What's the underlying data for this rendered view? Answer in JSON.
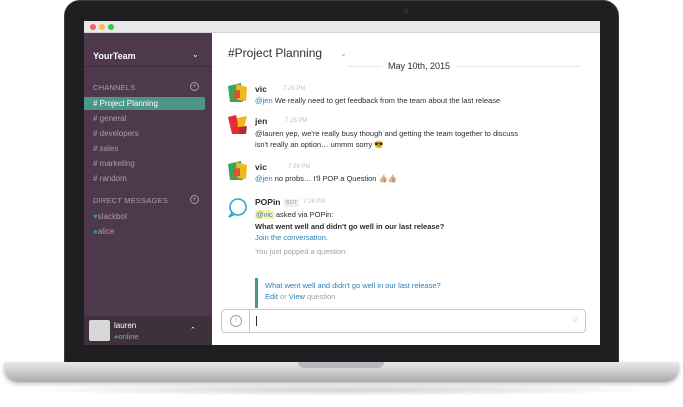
{
  "window": {
    "dots": [
      "#fc605c",
      "#fdbc40",
      "#34c84a"
    ]
  },
  "sidebar": {
    "team_name": "YourTeam",
    "team_caret": "⌄",
    "channels_heading": "CHANNELS",
    "add_channel": "+",
    "channels": [
      {
        "label": "# Project Planning",
        "active": true
      },
      {
        "label": "# general"
      },
      {
        "label": "# developers"
      },
      {
        "label": "# sales"
      },
      {
        "label": "# marketing"
      },
      {
        "label": "# random"
      }
    ],
    "dm_heading": "DIRECT MESSAGES",
    "add_dm": "+",
    "dms": [
      {
        "presence": "♥",
        "label": "slackbot"
      },
      {
        "presence": "●",
        "label": "alice"
      }
    ],
    "user": {
      "name": "lauren",
      "presence": "●",
      "status": "online",
      "caret": "⌃"
    }
  },
  "main": {
    "channel_title": "#Project Planning",
    "channel_caret": "⌄",
    "date_divider": "May 10th, 2015",
    "messages": [
      {
        "name": "vic",
        "time": "7:26 PM",
        "mention": "@jen",
        "text": " We really need to get feedback from the team about the last release"
      },
      {
        "name": "jen",
        "time": "7:26 PM",
        "line1": "@lauren yep, we're really busy though and getting the team together to discuss",
        "line2": "isn't really an option… ummm sorry 😎"
      },
      {
        "name": "vic",
        "time": "7:26 PM",
        "mention": "@jen",
        "text": " no probs… I'll POP a Question 👍🏼👍🏼"
      },
      {
        "name": "POPin",
        "badge": "BOT",
        "time": "7:26 PM",
        "highlight": "@vic",
        "asked": " asked via POPin:",
        "question": "What went well and didn't go well in our last release?",
        "join": "Join the conversation.",
        "popped": "You just popped a question:",
        "quote_question": "What went well and didn't go well in our last release?",
        "edit": "Edit",
        "or": " or ",
        "view": "View",
        "question_word": " question"
      }
    ],
    "composer": {
      "upload": "↑",
      "value": "",
      "emoji": "☺"
    }
  },
  "colors": {
    "sidebar": "#4d394b",
    "active_channel": "#4c9689",
    "link": "#2a80b9",
    "presence": "#38978d"
  }
}
